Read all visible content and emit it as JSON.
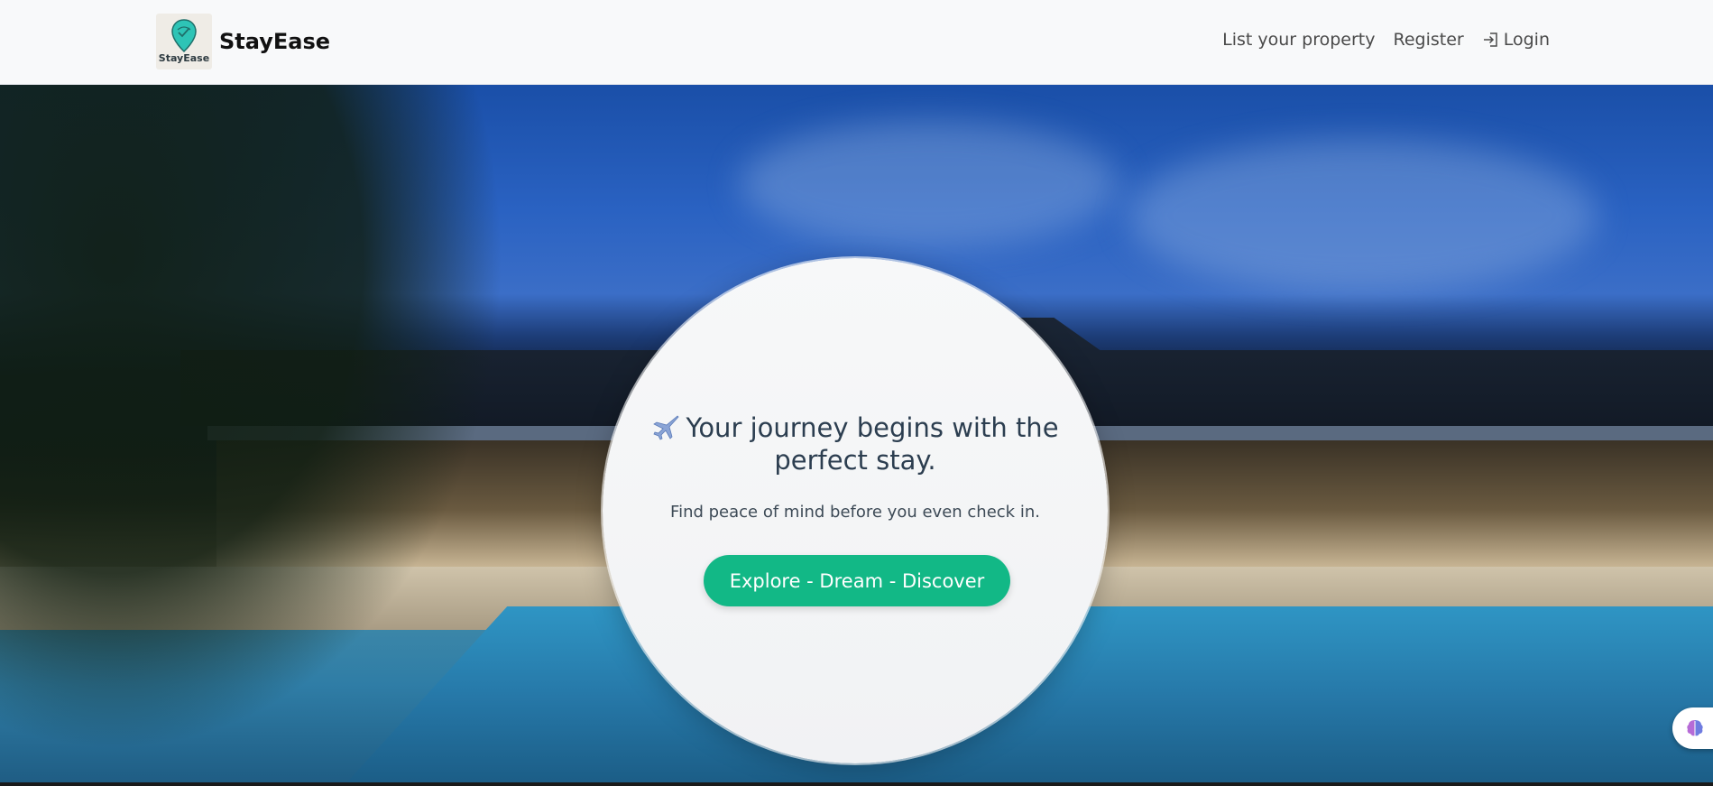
{
  "brand": {
    "logo_text": "StayEase",
    "name": "StayEase",
    "logo_icon": "map-pin-icon"
  },
  "nav": {
    "links": [
      {
        "label": "List your property"
      },
      {
        "label": "Register"
      },
      {
        "label": "Login",
        "icon": "login-icon"
      }
    ]
  },
  "hero": {
    "headline_icon": "airplane-icon",
    "headline": "Your journey begins with the perfect stay.",
    "subtext": "Find peace of mind before you even check in.",
    "cta_label": "Explore - Dream - Discover"
  },
  "floating_widget": {
    "icon": "brain-icon"
  },
  "colors": {
    "accent": "#12b886",
    "navbar_bg": "#f8f9fa",
    "brand_text": "#111111",
    "headline_text": "#2c3e50"
  }
}
